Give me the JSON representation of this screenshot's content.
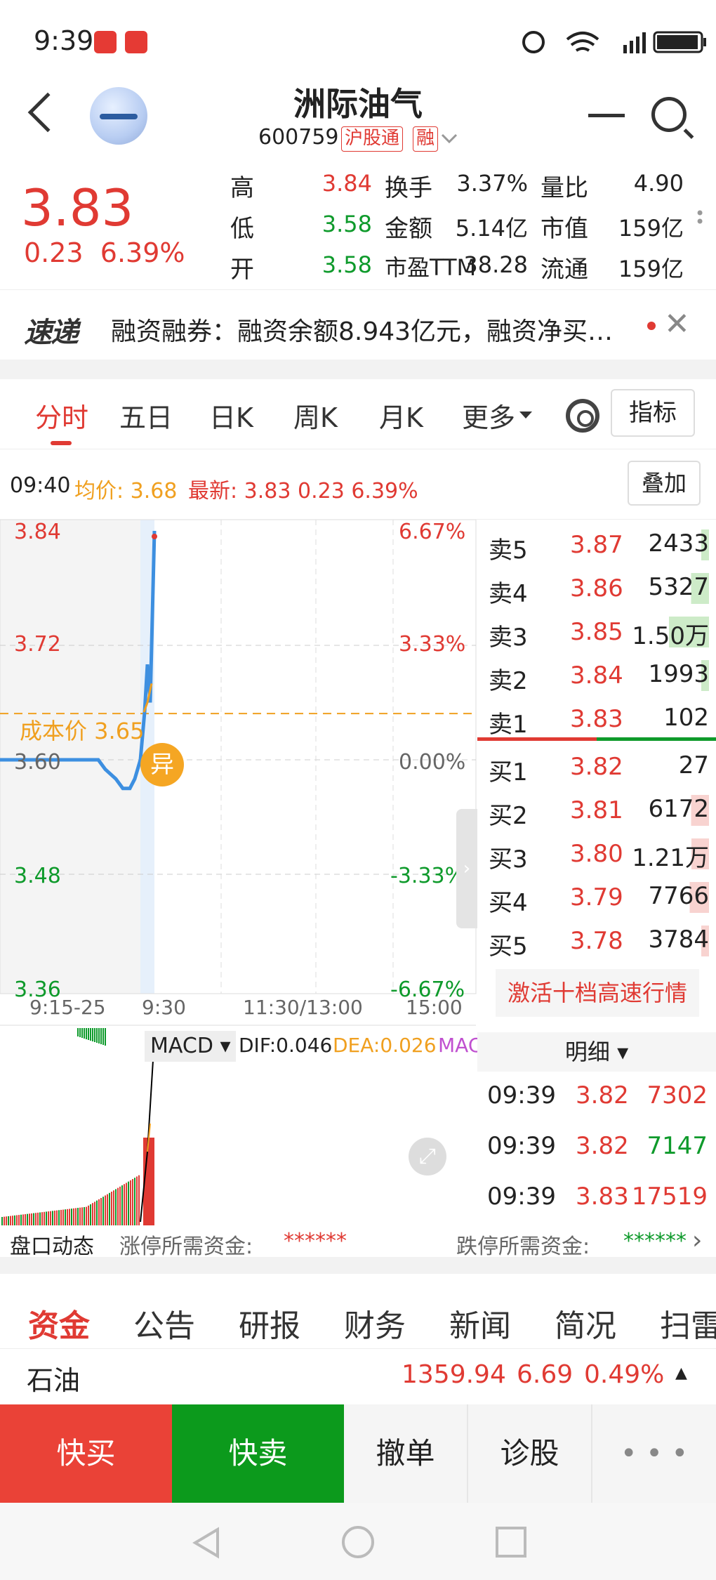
{
  "status": {
    "time": "9:39"
  },
  "header": {
    "title": "洲际油气",
    "code": "600759",
    "tag1": "沪股通",
    "tag2": "融"
  },
  "quote": {
    "price": "3.83",
    "change": "0.23",
    "pct": "6.39%",
    "labels": [
      "高",
      "低",
      "开",
      "换手",
      "金额",
      "市盈TTM",
      "量比",
      "市值",
      "流通"
    ],
    "values": [
      "3.84",
      "3.58",
      "3.58",
      "3.37%",
      "5.14亿",
      "38.28",
      "4.90",
      "159亿",
      "159亿"
    ]
  },
  "banner": {
    "logo": "速递",
    "text": "融资融券：融资余额8.943亿元，融资净买…"
  },
  "tabs": [
    "分时",
    "五日",
    "日K",
    "周K",
    "月K",
    "更多"
  ],
  "indicator_btn": "指标",
  "info": {
    "time": "09:40",
    "avg_label": "均价:",
    "avg": "3.68",
    "last_label": "最新:",
    "last": "3.83 0.23 6.39%",
    "overlay": "叠加"
  },
  "chart_data": {
    "type": "line",
    "y_left": [
      "3.84",
      "3.72",
      "3.60",
      "3.48",
      "3.36"
    ],
    "y_right": [
      "6.67%",
      "3.33%",
      "0.00%",
      "-3.33%",
      "-6.67%"
    ],
    "x_labels": [
      "9:15-25",
      "9:30",
      "11:30/13:00",
      "15:00"
    ],
    "cost_label": "成本价 3.65",
    "anomaly": "异",
    "ylim": [
      3.36,
      3.84
    ],
    "price": [
      3.6,
      3.6,
      3.6,
      3.6,
      3.6,
      3.6,
      3.59,
      3.58,
      3.57,
      3.57,
      3.58,
      3.6,
      3.65,
      3.7,
      3.66,
      3.84
    ],
    "macd": {
      "name": "MACD",
      "dif_label": "DIF:0.046",
      "dea_label": "DEA:0.026",
      "macd_label": "MAC"
    },
    "colors": {
      "price": "#3d8fe0",
      "avg": "#f0a020",
      "up": "#e03a33",
      "down": "#0e9a2b"
    }
  },
  "book": {
    "sells": [
      {
        "l": "卖5",
        "p": "3.87",
        "v": "2433"
      },
      {
        "l": "卖4",
        "p": "3.86",
        "v": "5327"
      },
      {
        "l": "卖3",
        "p": "3.85",
        "v": "1.50万"
      },
      {
        "l": "卖2",
        "p": "3.84",
        "v": "1993"
      },
      {
        "l": "卖1",
        "p": "3.83",
        "v": "102"
      }
    ],
    "buys": [
      {
        "l": "买1",
        "p": "3.82",
        "v": "27"
      },
      {
        "l": "买2",
        "p": "3.81",
        "v": "6172"
      },
      {
        "l": "买3",
        "p": "3.80",
        "v": "1.21万"
      },
      {
        "l": "买4",
        "p": "3.79",
        "v": "7766"
      },
      {
        "l": "买5",
        "p": "3.78",
        "v": "3784"
      }
    ],
    "activate": "激活十档高速行情"
  },
  "detail": {
    "title": "明细",
    "rows": [
      {
        "t": "09:39",
        "p": "3.82",
        "v": "7302"
      },
      {
        "t": "09:39",
        "p": "3.82",
        "v": "7147"
      },
      {
        "t": "09:39",
        "p": "3.83",
        "v": "17519"
      }
    ]
  },
  "pankou": {
    "title": "盘口动态",
    "up_label": "涨停所需资金:",
    "up_val": "******",
    "down_label": "跌停所需资金:",
    "down_val": "******"
  },
  "subtabs": [
    "资金",
    "公告",
    "研报",
    "财务",
    "新闻",
    "简况",
    "扫雷"
  ],
  "oil": {
    "name": "石油",
    "value": "1359.94",
    "chg": "6.69",
    "pct": "0.49%"
  },
  "actions": [
    "快买",
    "快卖",
    "撤单",
    "诊股"
  ]
}
